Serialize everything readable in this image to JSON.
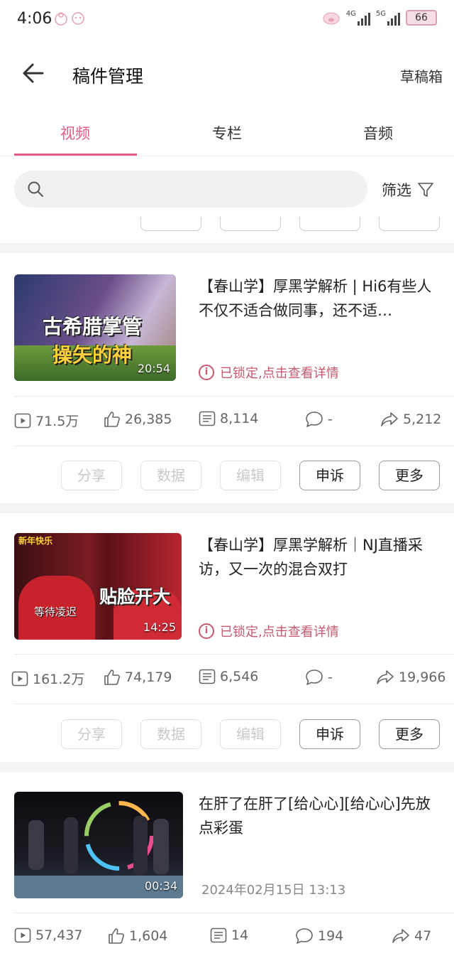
{
  "status_bar": {
    "time": "4:06",
    "net1": "4G",
    "net2": "5G",
    "battery": "66"
  },
  "header": {
    "title": "稿件管理",
    "drafts": "草稿箱"
  },
  "tabs": [
    {
      "label": "视频",
      "active": true
    },
    {
      "label": "专栏",
      "active": false
    },
    {
      "label": "音频",
      "active": false
    }
  ],
  "search": {
    "placeholder": "",
    "filter_label": "筛选"
  },
  "accent_color": "#e05b86",
  "locked_color": "#c8596f",
  "videos": [
    {
      "title": "【春山学】厚黑学解析 | Hi6有些人不仅不适合做同事，还不适…",
      "thumb_caption_1": "古希腊掌管",
      "thumb_caption_2": "操矢的神",
      "duration": "20:54",
      "status": "已锁定,点击查看详情",
      "stats": {
        "plays": "71.5万",
        "likes": "26,385",
        "danmaku": "8,114",
        "comments": "-",
        "shares": "5,212"
      }
    },
    {
      "title": "【春山学】厚黑学解析｜NJ直播采访，又一次的混合双打",
      "thumb_caption_1": "贴脸开大",
      "thumb_caption_2": "等待凌迟",
      "thumb_corner": "新年快乐",
      "duration": "14:25",
      "status": "已锁定,点击查看详情",
      "stats": {
        "plays": "161.2万",
        "likes": "74,179",
        "danmaku": "6,546",
        "comments": "-",
        "shares": "19,966"
      }
    },
    {
      "title": "在肝了在肝了[给心心][给心心]先放点彩蛋",
      "duration": "00:34",
      "date": "2024年02月15日 13:13",
      "stats": {
        "plays": "57,437",
        "likes": "1,604",
        "danmaku": "14",
        "comments": "194",
        "shares": "47"
      }
    }
  ],
  "actions": {
    "share": "分享",
    "data": "数据",
    "edit": "编辑",
    "appeal": "申诉",
    "more": "更多"
  }
}
